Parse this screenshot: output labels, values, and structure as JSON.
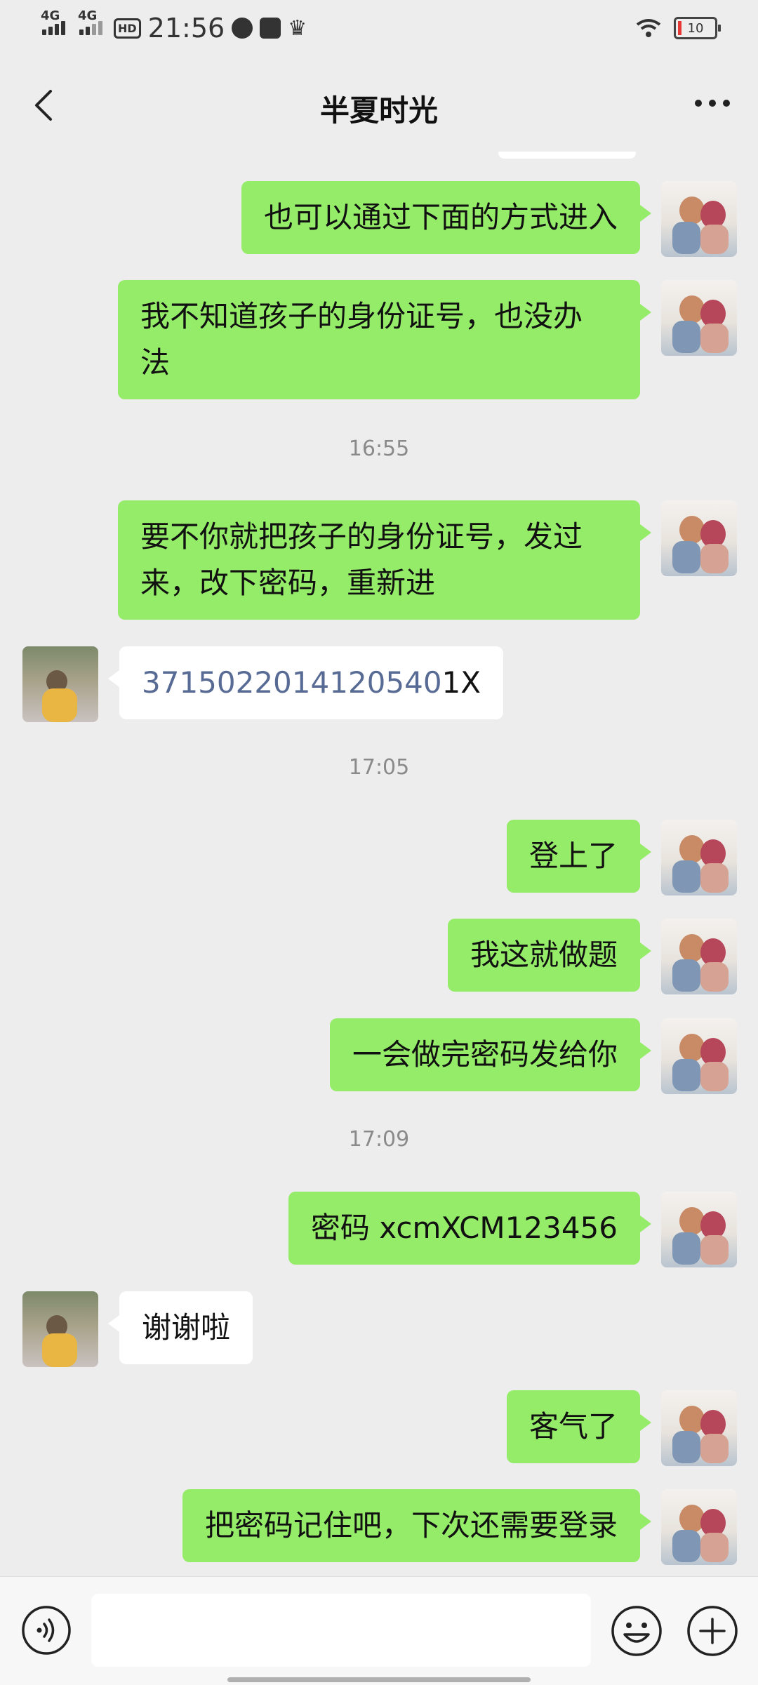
{
  "status_bar": {
    "time": "21:56",
    "signal_1": "4G",
    "signal_2": "4G",
    "hd": "HD",
    "battery": "10"
  },
  "header": {
    "title": "半夏时光"
  },
  "messages": [
    {
      "from": "me",
      "text": "也可以通过下面的方式进入"
    },
    {
      "from": "me",
      "text": "我不知道孩子的身份证号，也没办\n法"
    },
    {
      "time": "16:55"
    },
    {
      "from": "me",
      "text": "要不你就把孩子的身份证号，发过\n来，改下密码，重新进"
    },
    {
      "from": "other",
      "text_link": "3715022014120540",
      "text_rest": "1X"
    },
    {
      "time": "17:05"
    },
    {
      "from": "me",
      "text": "登上了"
    },
    {
      "from": "me",
      "text": "我这就做题"
    },
    {
      "from": "me",
      "text": "一会做完密码发给你"
    },
    {
      "time": "17:09"
    },
    {
      "from": "me",
      "text": "密码 xcmXCM123456"
    },
    {
      "from": "other",
      "text": "谢谢啦"
    },
    {
      "from": "me",
      "text": "客气了"
    },
    {
      "from": "me",
      "text": "把密码记住吧，下次还需要登录"
    }
  ],
  "input": {
    "value": "",
    "placeholder": ""
  },
  "icons": {
    "back": "back-icon",
    "more": "more-icon",
    "voice": "voice-icon",
    "emoji": "emoji-icon",
    "plus": "plus-icon"
  },
  "colors": {
    "background": "#ededed",
    "my_bubble": "#95ec69",
    "other_bubble": "#ffffff",
    "link_text": "#576b95"
  }
}
